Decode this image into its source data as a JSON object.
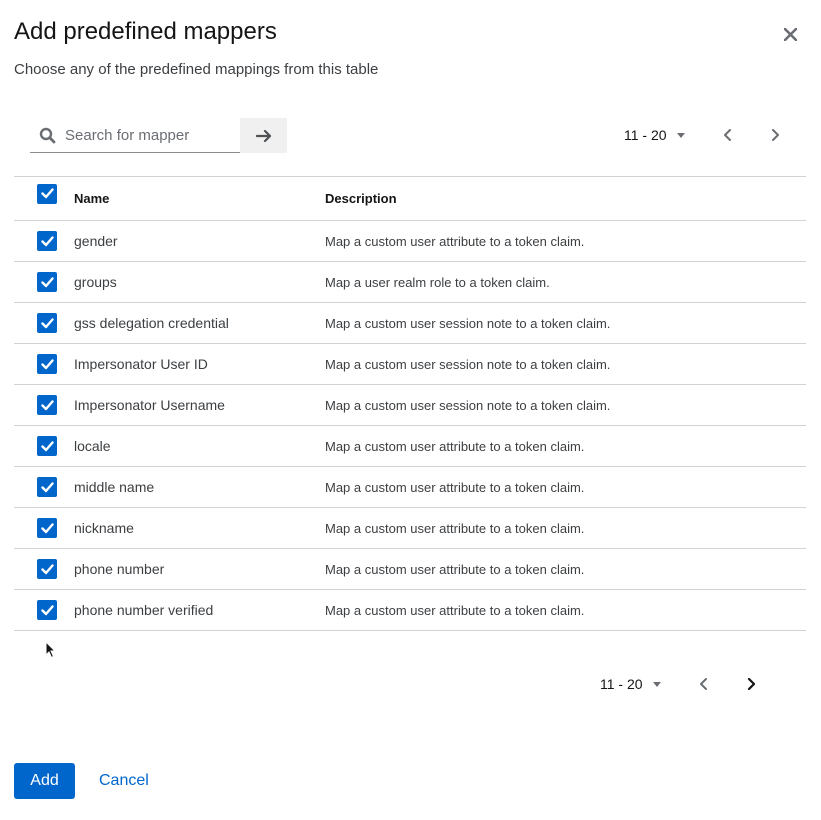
{
  "modal": {
    "title": "Add predefined mappers",
    "subtitle": "Choose any of the predefined mappings from this table"
  },
  "search": {
    "placeholder": "Search for mapper"
  },
  "pagination_top": {
    "range": "11 - 20"
  },
  "pagination_bottom": {
    "range": "11 - 20"
  },
  "table": {
    "headers": {
      "name": "Name",
      "description": "Description"
    },
    "rows": [
      {
        "name": "gender",
        "description": "Map a custom user attribute to a token claim.",
        "checked": true
      },
      {
        "name": "groups",
        "description": "Map a user realm role to a token claim.",
        "checked": true
      },
      {
        "name": "gss delegation credential",
        "description": "Map a custom user session note to a token claim.",
        "checked": true
      },
      {
        "name": "Impersonator User ID",
        "description": "Map a custom user session note to a token claim.",
        "checked": true
      },
      {
        "name": "Impersonator Username",
        "description": "Map a custom user session note to a token claim.",
        "checked": true
      },
      {
        "name": "locale",
        "description": "Map a custom user attribute to a token claim.",
        "checked": true
      },
      {
        "name": "middle name",
        "description": "Map a custom user attribute to a token claim.",
        "checked": true
      },
      {
        "name": "nickname",
        "description": "Map a custom user attribute to a token claim.",
        "checked": true
      },
      {
        "name": "phone number",
        "description": "Map a custom user attribute to a token claim.",
        "checked": true
      },
      {
        "name": "phone number verified",
        "description": "Map a custom user attribute to a token claim.",
        "checked": true
      }
    ]
  },
  "actions": {
    "add": "Add",
    "cancel": "Cancel"
  },
  "colors": {
    "primary": "#0066cc",
    "border": "#d2d2d2",
    "text": "#151515"
  }
}
